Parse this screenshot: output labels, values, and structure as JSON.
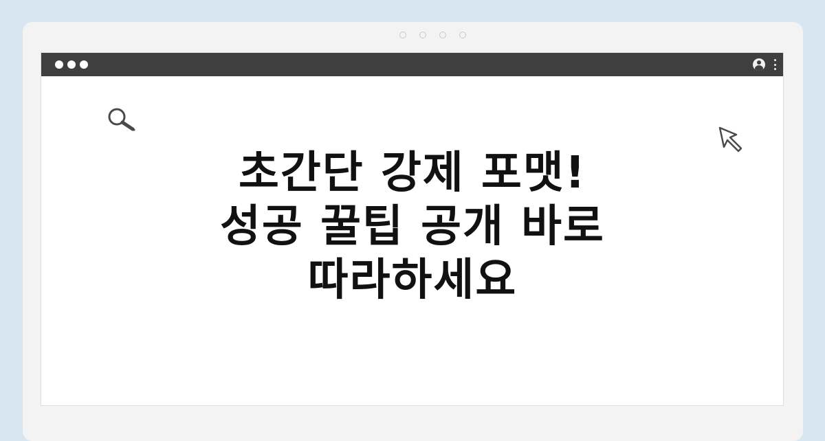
{
  "headline": {
    "line1": "초간단 강제 포맷!",
    "line2": "성공 꿀팁 공개 바로",
    "line3": "따라하세요"
  },
  "icons": {
    "search": "search-icon",
    "cursor": "cursor-arrow-icon",
    "profile": "profile-icon",
    "menu": "kebab-menu-icon"
  },
  "colors": {
    "background": "#d8e6f1",
    "card": "#f3f3f3",
    "titlebar": "#3f3f3f",
    "window": "#ffffff",
    "text": "#111111"
  }
}
